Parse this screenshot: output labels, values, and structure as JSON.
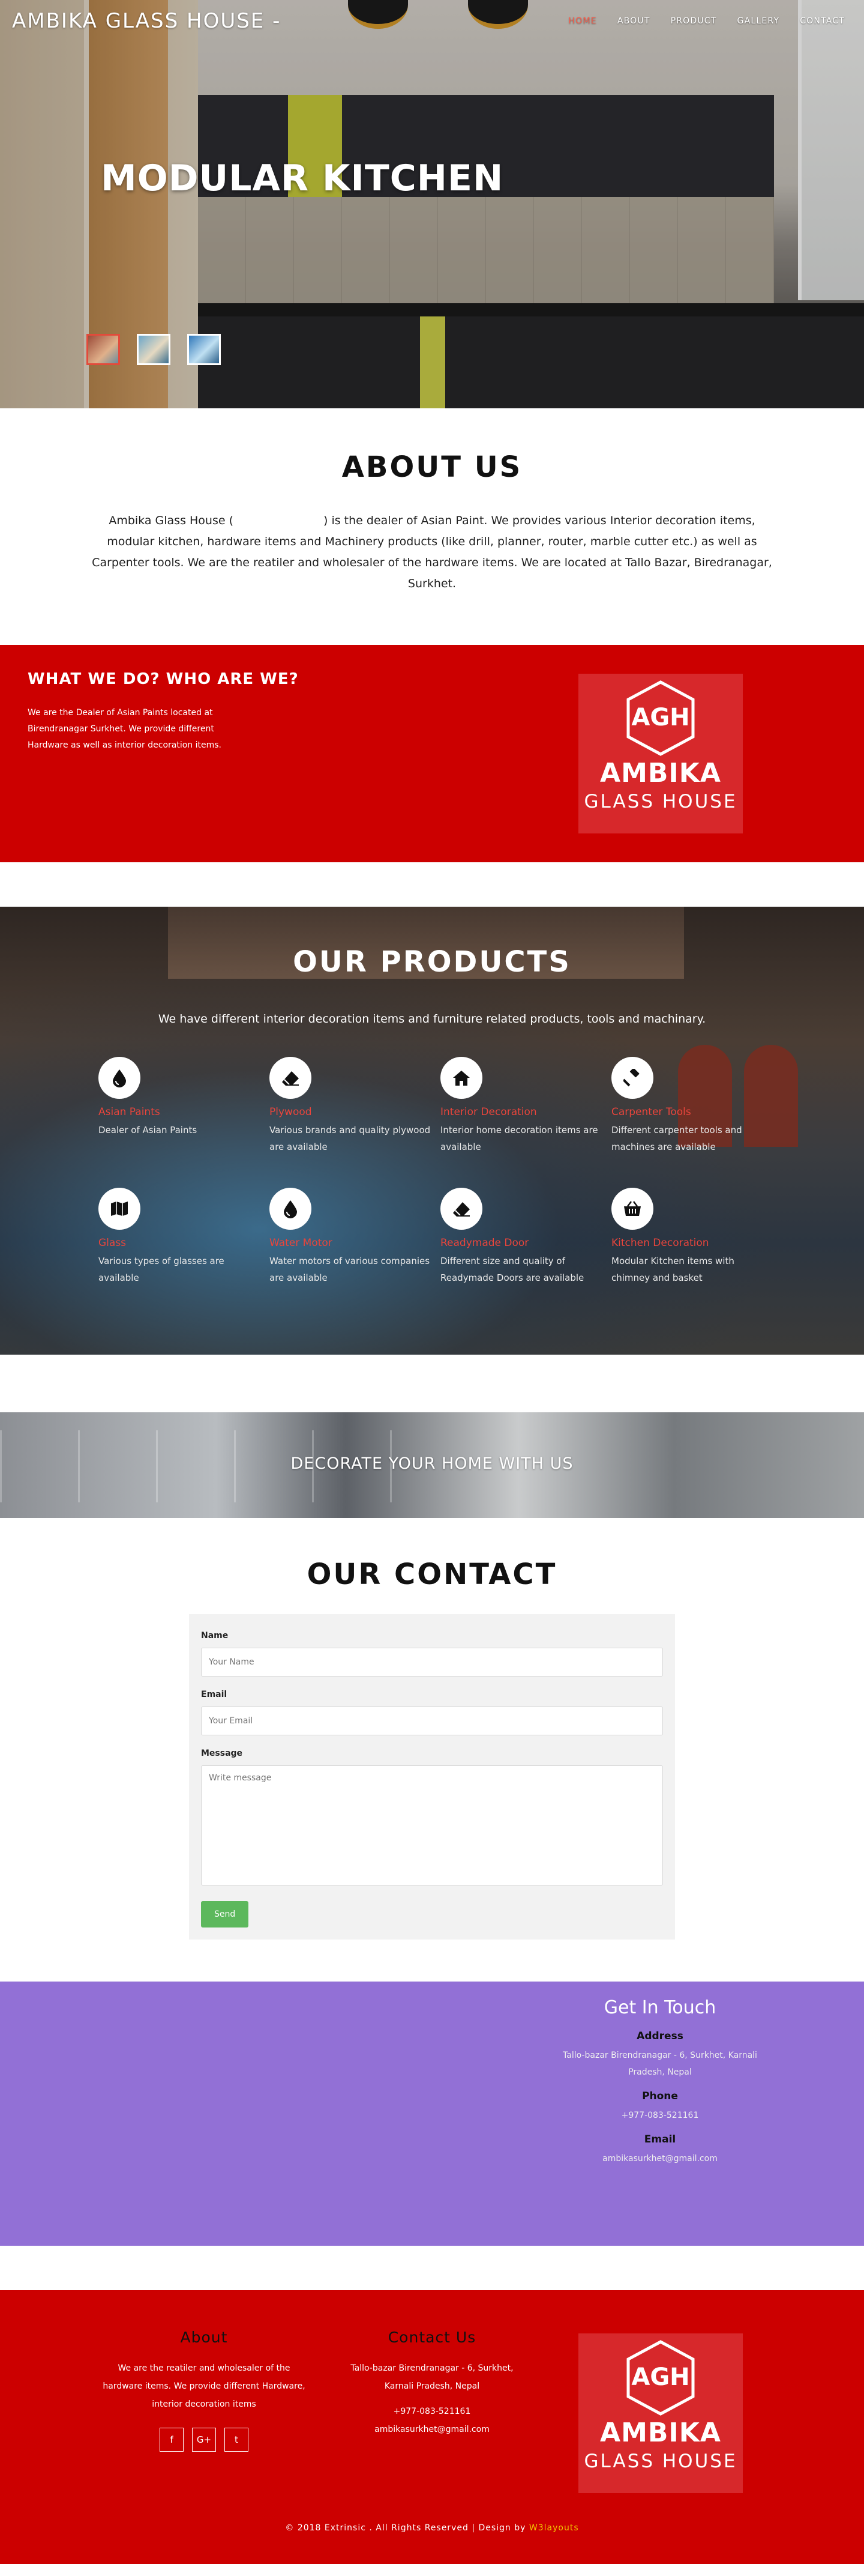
{
  "header": {
    "brand": "AMBIKA GLASS HOUSE -",
    "nav": [
      "HOME",
      "ABOUT",
      "PRODUCT",
      "GALLERY",
      "CONTACT"
    ],
    "active_nav": "HOME"
  },
  "hero": {
    "title": "MODULAR KITCHEN"
  },
  "about": {
    "title": "ABOUT US",
    "text_before": "Ambika Glass House (",
    "text_after": ") is the dealer of Asian Paint. We provides various Interior decoration items, modular kitchen, hardware items and Machinery products (like drill, planner, router, marble cutter etc.) as well as Carpenter tools. We are the reatiler and wholesaler of the hardware items. We are located at Tallo Bazar, Biredranagar, Surkhet."
  },
  "what": {
    "title": "WHAT WE DO? WHO ARE WE?",
    "text": "We are the Dealer of Asian Paints located at Birendranagar Surkhet. We provide different Hardware as well as interior decoration items."
  },
  "logo": {
    "initials": "AGH",
    "name": "AMBIKA",
    "sub": "GLASS HOUSE"
  },
  "products": {
    "title": "OUR PRODUCTS",
    "lead": "We have different interior decoration items and furniture related products, tools and machinary.",
    "items": [
      {
        "name": "Asian Paints",
        "desc": "Dealer of Asian Paints",
        "icon": "tint-icon"
      },
      {
        "name": "Plywood",
        "desc": "Various brands and quality plywood are available",
        "icon": "eraser-icon"
      },
      {
        "name": "Interior Decoration",
        "desc": "Interior home decoration items are available",
        "icon": "home-icon"
      },
      {
        "name": "Carpenter Tools",
        "desc": "Different carpenter tools and machines are available",
        "icon": "gavel-icon"
      },
      {
        "name": "Glass",
        "desc": "Various types of glasses are available",
        "icon": "map-icon"
      },
      {
        "name": "Water Motor",
        "desc": "Water motors of various companies are available",
        "icon": "tint-icon"
      },
      {
        "name": "Readymade Door",
        "desc": "Different size and quality of Readymade Doors are available",
        "icon": "eraser-icon"
      },
      {
        "name": "Kitchen Decoration",
        "desc": "Modular Kitchen items with chimney and basket",
        "icon": "basket-icon"
      }
    ]
  },
  "decorate": {
    "text": "DECORATE YOUR HOME WITH US"
  },
  "contact": {
    "title": "OUR CONTACT",
    "name_label": "Name",
    "name_placeholder": "Your Name",
    "email_label": "Email",
    "email_placeholder": "Your Email",
    "message_label": "Message",
    "message_placeholder": "Write message",
    "send_label": "Send"
  },
  "touch": {
    "title": "Get In Touch",
    "address_label": "Address",
    "address": "Tallo-bazar Birendranagar - 6, Surkhet, Karnali Pradesh, Nepal",
    "phone_label": "Phone",
    "phone": "+977-083-521161",
    "email_label": "Email",
    "email": "ambikasurkhet@gmail.com"
  },
  "footer": {
    "about_title": "About",
    "about_text": "We are the reatiler and wholesaler of the hardware items. We provide different Hardware, interior decoration items",
    "social": [
      "f",
      "G+",
      "t"
    ],
    "contact_title": "Contact Us",
    "contact_address": "Tallo-bazar Birendranagar - 6, Surkhet, Karnali Pradesh, Nepal",
    "contact_phone": "+977-083-521161",
    "contact_email": "ambikasurkhet@gmail.com",
    "copyright": "© 2018 Extrinsic . All Rights Reserved | Design by",
    "credit": "W3layouts"
  },
  "colors": {
    "red": "#cc0000",
    "purple": "#9270d6",
    "accent": "#e8453c",
    "send": "#5cb85c"
  }
}
